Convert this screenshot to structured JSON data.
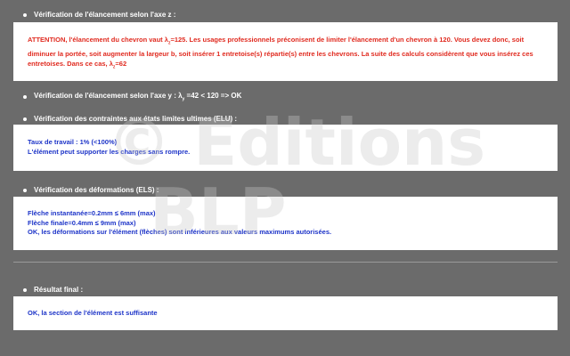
{
  "sections": [
    {
      "heading_main": "Vérification de l'élancement selon l'axe z :"
    },
    {
      "heading_pre": "Vérification de l'élancement selon l'axe y : λ",
      "heading_sub": "y",
      "heading_post": " =42 < 120 => OK"
    },
    {
      "heading_main": "Vérification des contraintes aux états limites ultimes (ELU) :"
    },
    {
      "heading_main": "Vérification des déformations (ELS) :"
    },
    {
      "heading_main": "Résultat final :"
    }
  ],
  "alert": {
    "part1": "ATTENTION, l'élancement du chevron vaut λ",
    "sub1": "z",
    "part2": "=125. Les usages professionnels préconisent de limiter l'élancement d'un chevron à 120. Vous devez donc, soit diminuer la portée, soit augmenter la largeur b, soit insérer 1 entretoise(s) répartie(s) entre les chevrons. La suite des calculs considèrent que vous insérez ces entretoises. Dans ce cas, λ",
    "sub2": "z",
    "part3": "=62"
  },
  "elu": {
    "line1": "Taux de travail : 1% (<100%)",
    "line2": "L'élément peut supporter les charges sans rompre."
  },
  "els": {
    "line1": "Flèche instantanée=0.2mm ≤ 6mm (max)",
    "line2": "Flèche finale=0.4mm ≤ 9mm (max)",
    "line3": "OK, les déformations sur l'élément (flèches) sont inférieures aux valeurs maximums autorisées."
  },
  "final": {
    "line1": "OK, la section de l'élément est suffisante"
  },
  "watermark": {
    "line1": "© Editions",
    "line2": "BLP"
  },
  "colors": {
    "background": "#6b6b6b",
    "alert_text": "#e02a1f",
    "info_text": "#1d34c8"
  }
}
